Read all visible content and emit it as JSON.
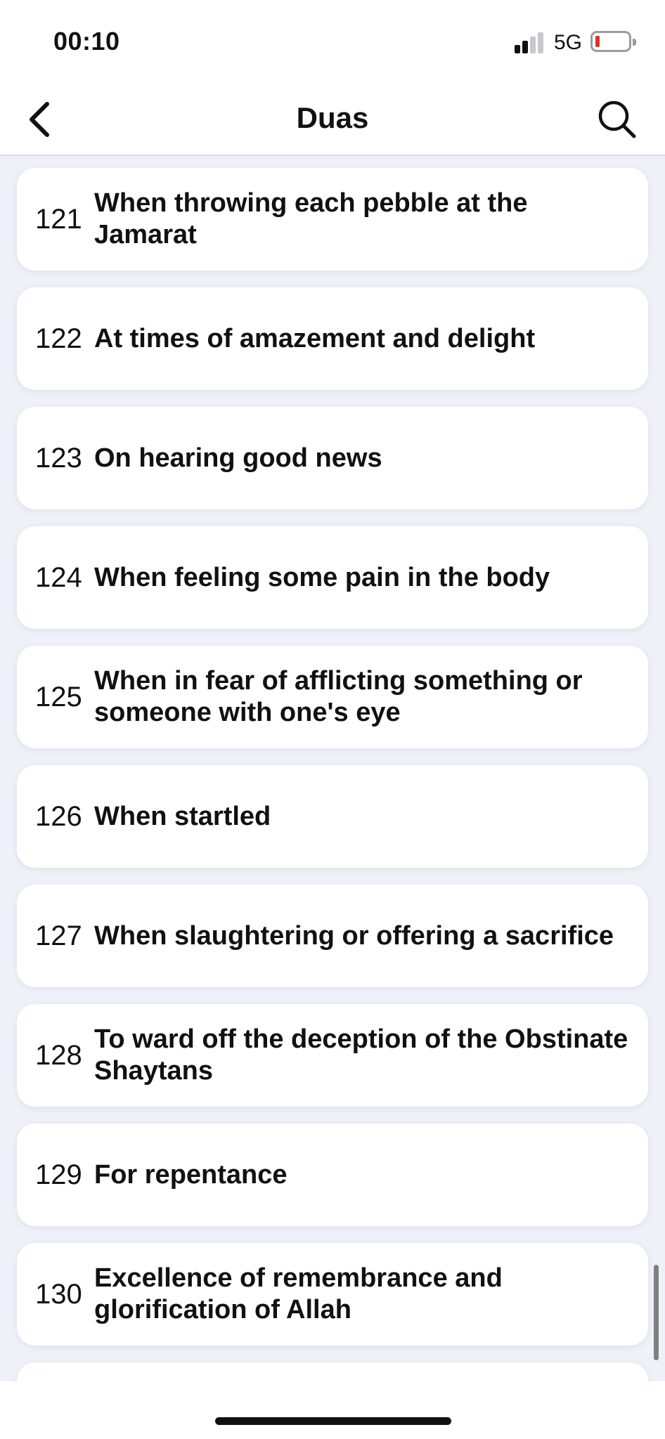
{
  "status_bar": {
    "time": "00:10",
    "network": "5G",
    "signal_bars_active": 2,
    "signal_bars_total": 4,
    "battery_level": "low",
    "battery_color": "#e0302b"
  },
  "nav": {
    "title": "Duas",
    "back_icon": "chevron-left-icon",
    "search_icon": "search-icon"
  },
  "duas": [
    {
      "number": "121",
      "title": "When throwing each pebble at the Jamarat"
    },
    {
      "number": "122",
      "title": "At times of amazement and delight"
    },
    {
      "number": "123",
      "title": "On hearing good news"
    },
    {
      "number": "124",
      "title": "When feeling some pain in the body"
    },
    {
      "number": "125",
      "title": "When in fear of afflicting something or someone with one's eye"
    },
    {
      "number": "126",
      "title": "When startled"
    },
    {
      "number": "127",
      "title": "When slaughtering or offering a sacrifice"
    },
    {
      "number": "128",
      "title": "To ward off the deception of the Obstinate Shaytans"
    },
    {
      "number": "129",
      "title": "For repentance"
    },
    {
      "number": "130",
      "title": "Excellence of remembrance and glorification of Allah"
    },
    {
      "number": "",
      "title": ""
    }
  ],
  "colors": {
    "background": "#eef1f7",
    "card": "#ffffff",
    "text": "#111111"
  }
}
